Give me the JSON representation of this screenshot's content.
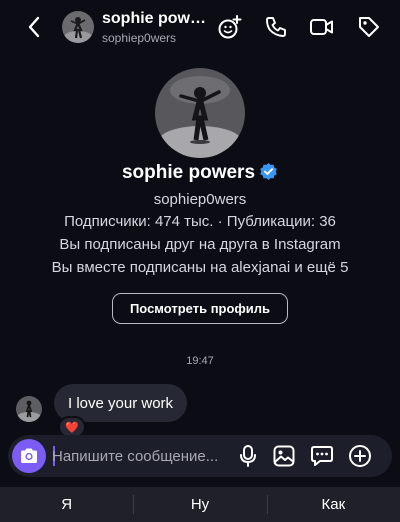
{
  "header": {
    "name": "sophie pow…",
    "username": "sophiep0wers",
    "icons": [
      "back-chevron-icon",
      "add-person-icon",
      "phone-icon",
      "video-icon",
      "tag-icon"
    ]
  },
  "profile": {
    "name": "sophie powers",
    "verified": true,
    "username": "sophiep0wers",
    "stats_line": "Подписчики: 474 тыс. · Публикации: 36",
    "mutual_follow_line": "Вы подписаны друг на друга в Instagram",
    "mutual_friends_line": "Вы вместе подписаны на alexjanai и ещё 5",
    "view_profile_label": "Посмотреть профиль"
  },
  "conversation": {
    "timestamp": "19:47",
    "messages": [
      {
        "text": "I love your work",
        "reaction": "❤️"
      }
    ]
  },
  "composer": {
    "placeholder": "Напишите сообщение...",
    "value": ""
  },
  "keyboard_suggestions": [
    "Я",
    "Ну",
    "Как"
  ],
  "colors": {
    "background": "#0b0c14",
    "bubble": "#262833",
    "accent": "#7b5cf5",
    "verified": "#3897f0",
    "muted_text": "#a8a9b4"
  }
}
